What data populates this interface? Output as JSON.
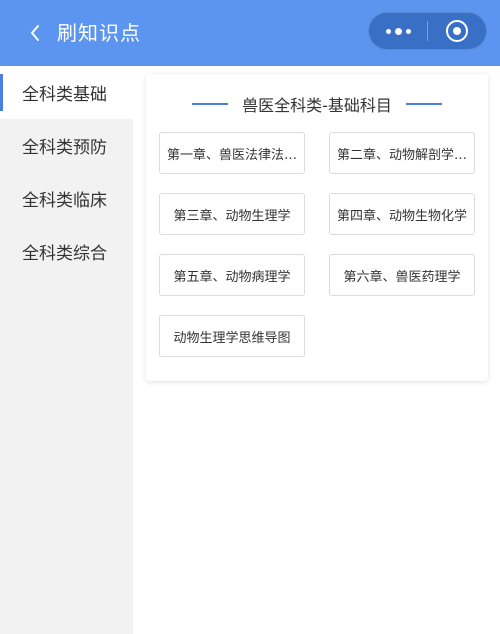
{
  "header": {
    "title": "刷知识点",
    "back_icon": "chevron-left-icon",
    "more_icon": "more-dots-icon",
    "close_icon": "target-circle-icon",
    "bar_color": "#5b95f0"
  },
  "sidebar": {
    "active_index": 0,
    "items": [
      {
        "label": "全科类基础"
      },
      {
        "label": "全科类预防"
      },
      {
        "label": "全科类临床"
      },
      {
        "label": "全科类综合"
      }
    ]
  },
  "main": {
    "section_title": "兽医全科类-基础科目",
    "accent_color": "#4a7fe0",
    "chapters": [
      {
        "label": "第一章、兽医法律法…"
      },
      {
        "label": "第二章、动物解剖学…"
      },
      {
        "label": "第三章、动物生理学"
      },
      {
        "label": "第四章、动物生物化学"
      },
      {
        "label": "第五章、动物病理学"
      },
      {
        "label": "第六章、兽医药理学"
      },
      {
        "label": "动物生理学思维导图"
      }
    ]
  }
}
